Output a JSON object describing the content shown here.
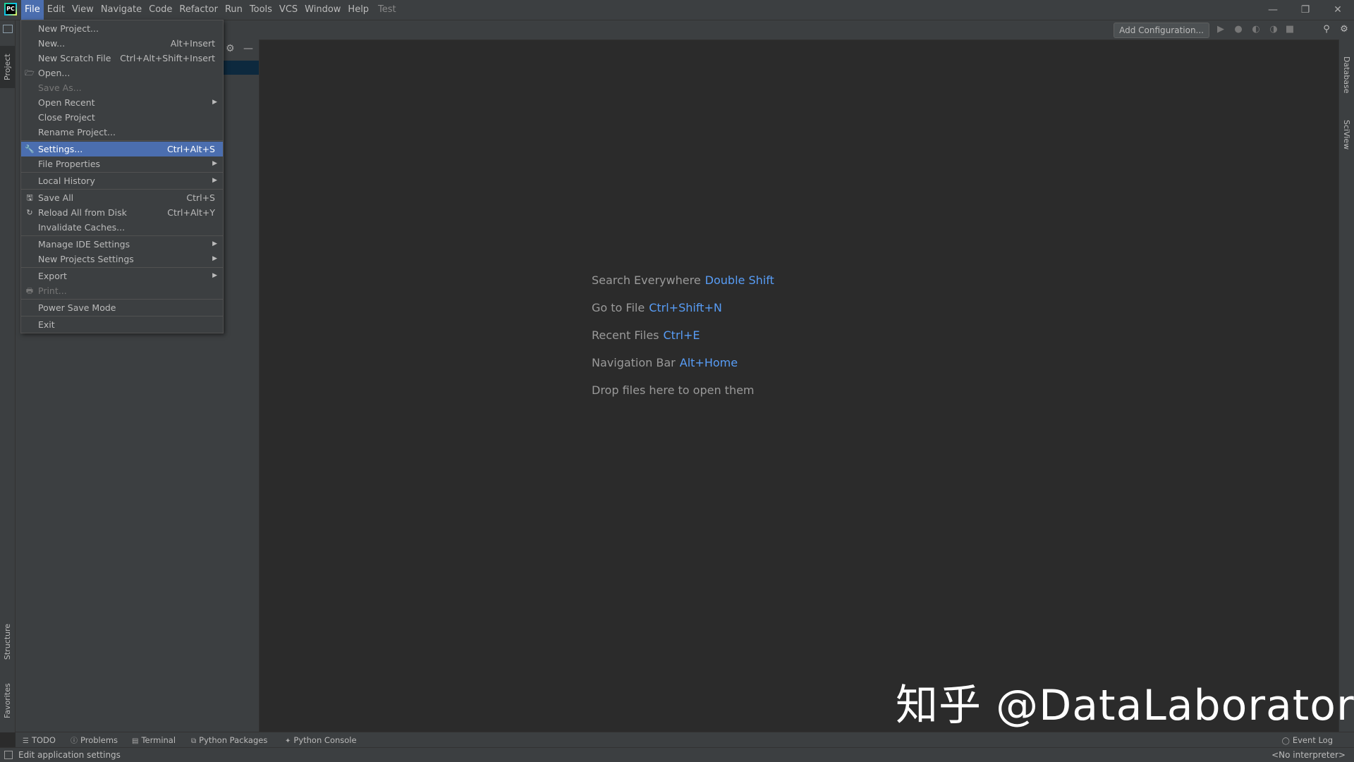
{
  "app": {
    "logo_text": "PC",
    "project_name": "Test"
  },
  "menubar": [
    "File",
    "Edit",
    "View",
    "Navigate",
    "Code",
    "Refactor",
    "Run",
    "Tools",
    "VCS",
    "Window",
    "Help"
  ],
  "window_controls": {
    "minimize": "—",
    "restore": "❐",
    "close": "✕"
  },
  "toolbar": {
    "add_configuration": "Add Configuration..."
  },
  "left_tabs": {
    "project": "Project",
    "structure": "Structure",
    "favorites": "Favorites"
  },
  "right_tabs": {
    "database": "Database",
    "sciview": "SciView"
  },
  "file_menu": [
    {
      "label": "New Project...",
      "shortcut": "",
      "icon": "",
      "arrow": false,
      "state": "normal"
    },
    {
      "label": "New...",
      "shortcut": "Alt+Insert",
      "icon": "",
      "arrow": false,
      "state": "normal"
    },
    {
      "label": "New Scratch File",
      "shortcut": "Ctrl+Alt+Shift+Insert",
      "icon": "",
      "arrow": false,
      "state": "normal"
    },
    {
      "label": "Open...",
      "shortcut": "",
      "icon": "folder-icon",
      "arrow": false,
      "state": "normal"
    },
    {
      "label": "Save As...",
      "shortcut": "",
      "icon": "",
      "arrow": false,
      "state": "disabled"
    },
    {
      "label": "Open Recent",
      "shortcut": "",
      "icon": "",
      "arrow": true,
      "state": "normal"
    },
    {
      "label": "Close Project",
      "shortcut": "",
      "icon": "",
      "arrow": false,
      "state": "normal"
    },
    {
      "label": "Rename Project...",
      "shortcut": "",
      "icon": "",
      "arrow": false,
      "state": "normal"
    },
    {
      "sep": true
    },
    {
      "label": "Settings...",
      "shortcut": "Ctrl+Alt+S",
      "icon": "wrench-icon",
      "arrow": false,
      "state": "selected"
    },
    {
      "label": "File Properties",
      "shortcut": "",
      "icon": "",
      "arrow": true,
      "state": "normal"
    },
    {
      "sep": true
    },
    {
      "label": "Local History",
      "shortcut": "",
      "icon": "",
      "arrow": true,
      "state": "normal"
    },
    {
      "sep": true
    },
    {
      "label": "Save All",
      "shortcut": "Ctrl+S",
      "icon": "save-icon",
      "arrow": false,
      "state": "normal"
    },
    {
      "label": "Reload All from Disk",
      "shortcut": "Ctrl+Alt+Y",
      "icon": "reload-icon",
      "arrow": false,
      "state": "normal"
    },
    {
      "label": "Invalidate Caches...",
      "shortcut": "",
      "icon": "",
      "arrow": false,
      "state": "normal"
    },
    {
      "sep": true
    },
    {
      "label": "Manage IDE Settings",
      "shortcut": "",
      "icon": "",
      "arrow": true,
      "state": "normal"
    },
    {
      "label": "New Projects Settings",
      "shortcut": "",
      "icon": "",
      "arrow": true,
      "state": "normal"
    },
    {
      "sep": true
    },
    {
      "label": "Export",
      "shortcut": "",
      "icon": "",
      "arrow": true,
      "state": "normal"
    },
    {
      "label": "Print...",
      "shortcut": "",
      "icon": "print-icon",
      "arrow": false,
      "state": "disabled"
    },
    {
      "sep": true
    },
    {
      "label": "Power Save Mode",
      "shortcut": "",
      "icon": "",
      "arrow": false,
      "state": "normal"
    },
    {
      "sep": true
    },
    {
      "label": "Exit",
      "shortcut": "",
      "icon": "",
      "arrow": false,
      "state": "normal"
    }
  ],
  "welcome_hints": [
    {
      "text": "Search Everywhere",
      "key": "Double Shift"
    },
    {
      "text": "Go to File",
      "key": "Ctrl+Shift+N"
    },
    {
      "text": "Recent Files",
      "key": "Ctrl+E"
    },
    {
      "text": "Navigation Bar",
      "key": "Alt+Home"
    },
    {
      "text": "Drop files here to open them",
      "key": ""
    }
  ],
  "watermark": "知乎 @DataLaboratory",
  "bottom_tabs": [
    {
      "label": "TODO",
      "icon": "list-icon"
    },
    {
      "label": "Problems",
      "icon": "problems-icon"
    },
    {
      "label": "Terminal",
      "icon": "terminal-icon"
    },
    {
      "label": "Python Packages",
      "icon": "packages-icon"
    },
    {
      "label": "Python Console",
      "icon": "python-console-icon"
    }
  ],
  "event_log": "Event Log",
  "status": {
    "text": "Edit application settings",
    "interpreter": "<No interpreter>"
  },
  "colors": {
    "accent": "#4b6eaf",
    "link": "#589df6",
    "background": "#2b2b2b",
    "panel": "#3c3f41"
  }
}
